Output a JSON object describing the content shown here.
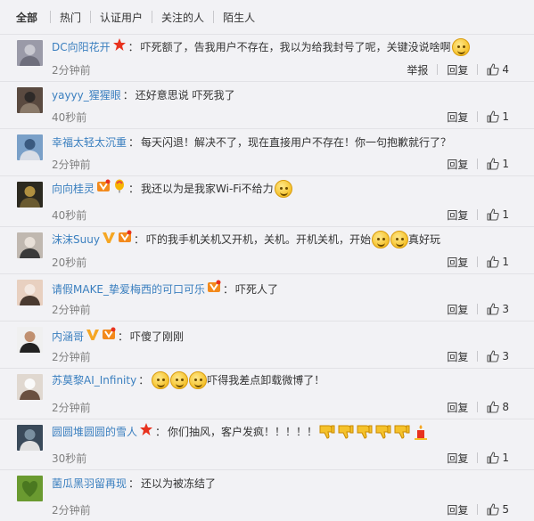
{
  "tabs": [
    {
      "label": "全部",
      "active": true
    },
    {
      "label": "热门",
      "active": false
    },
    {
      "label": "认证用户",
      "active": false
    },
    {
      "label": "关注的人",
      "active": false
    },
    {
      "label": "陌生人",
      "active": false
    }
  ],
  "colors": {
    "link": "#3a7fbf",
    "text": "#333333",
    "time": "#808080",
    "background": "#f2f2f5"
  },
  "comments": [
    {
      "user": "DC向阳花开",
      "badges": [
        "star-badge"
      ],
      "text": "吓死额了，告我用户不存在，我以为给我封号了呢，关键没说啥啊",
      "trailing_icons": [
        "confused-face-emoji"
      ],
      "time": "2分钟前",
      "report": "举报",
      "reply": "回复",
      "likes": "4"
    },
    {
      "user": "yayyy_猩猩眼",
      "badges": [],
      "text": "还好意思说 吓死我了",
      "trailing_icons": [],
      "time": "40秒前",
      "report": "",
      "reply": "回复",
      "likes": "1"
    },
    {
      "user": "幸福太轻太沉重",
      "badges": [],
      "text": "每天闪退！解决不了，现在直接用户不存在！你一句抱歉就行了？",
      "trailing_icons": [],
      "time": "2分钟前",
      "report": "",
      "reply": "回复",
      "likes": "1"
    },
    {
      "user": "向向桂灵",
      "badges": [
        "vip-badge",
        "balloon-badge"
      ],
      "text": "我还以为是我家Wi-Fi不给力",
      "trailing_icons": [
        "tired-face-emoji"
      ],
      "time": "40秒前",
      "report": "",
      "reply": "回复",
      "likes": "1"
    },
    {
      "user": "沫沫Suuy",
      "badges": [
        "verified-v-badge",
        "vip-badge"
      ],
      "text": "吓的我手机关机又开机，关机。开机关机，开始",
      "trailing_icons": [
        "smile-emoji",
        "smile-emoji"
      ],
      "text_after": "真好玩",
      "time": "20秒前",
      "report": "",
      "reply": "回复",
      "likes": "1"
    },
    {
      "user": "请假MAKE_挚爱梅西的可口可乐",
      "badges": [
        "vip-badge"
      ],
      "text": "吓死人了",
      "trailing_icons": [],
      "time": "2分钟前",
      "report": "",
      "reply": "回复",
      "likes": "3"
    },
    {
      "user": "内涵哥",
      "badges": [
        "verified-v-badge",
        "vip-badge"
      ],
      "text": "吓傻了刚刚",
      "trailing_icons": [],
      "time": "2分钟前",
      "report": "",
      "reply": "回复",
      "likes": "3"
    },
    {
      "user": "苏莫黎AI_Infinity",
      "badges": [],
      "text": "",
      "leading_icons": [
        "thinking-emoji",
        "thinking-emoji",
        "thinking-emoji"
      ],
      "text_after": "吓得我差点卸载微博了！",
      "trailing_icons": [],
      "time": "2分钟前",
      "report": "",
      "reply": "回复",
      "likes": "8"
    },
    {
      "user": "圆圆堆圆圆的雪人",
      "badges": [
        "star-badge"
      ],
      "text": "你们抽风，客户发疯！！！！！",
      "trailing_icons": [
        "thumbs-down-emoji",
        "thumbs-down-emoji",
        "thumbs-down-emoji",
        "thumbs-down-emoji",
        "thumbs-down-emoji",
        "candle-emoji"
      ],
      "time": "30秒前",
      "report": "",
      "reply": "回复",
      "likes": "1"
    },
    {
      "user": "菌瓜黑羽留再现",
      "badges": [],
      "text": "还以为被冻结了",
      "trailing_icons": [],
      "time": "2分钟前",
      "report": "",
      "reply": "回复",
      "likes": "5"
    }
  ]
}
